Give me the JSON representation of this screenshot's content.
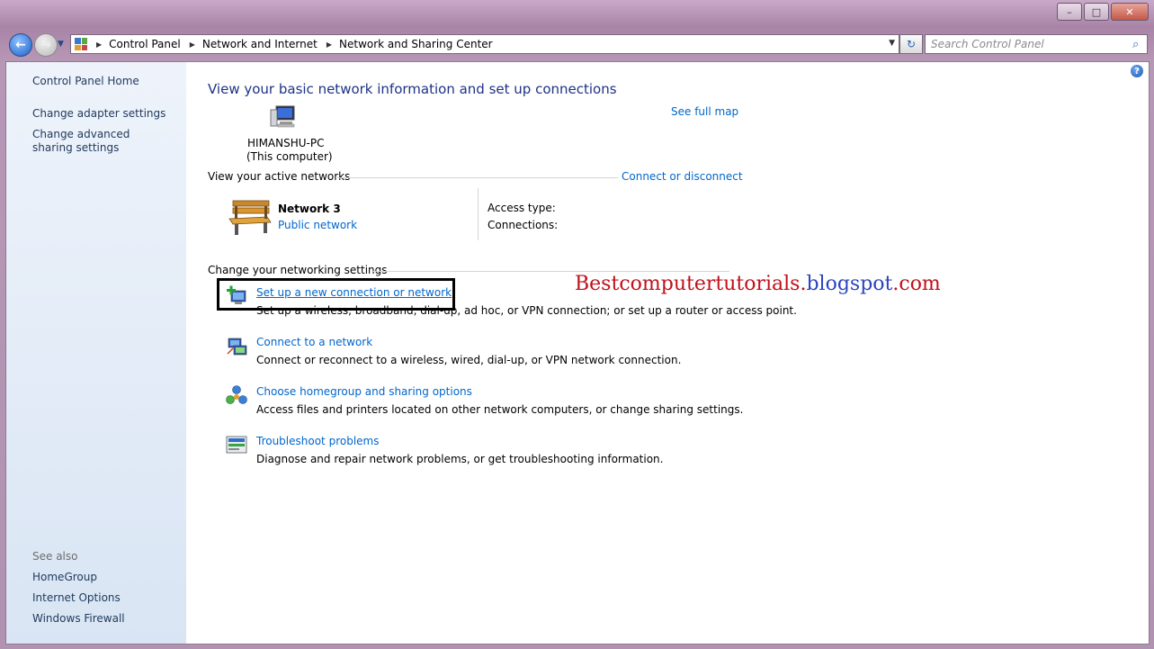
{
  "window": {
    "controls": {
      "minimize": "–",
      "maximize": "□",
      "close": "✕"
    }
  },
  "nav": {
    "back_icon": "back-arrow-icon",
    "forward_icon": "forward-arrow-icon",
    "breadcrumb": [
      "Control Panel",
      "Network and Internet",
      "Network and Sharing Center"
    ],
    "search_placeholder": "Search Control Panel"
  },
  "sidebar": {
    "home": "Control Panel Home",
    "links": [
      "Change adapter settings",
      "Change advanced sharing settings"
    ],
    "see_also_title": "See also",
    "see_also": [
      "HomeGroup",
      "Internet Options",
      "Windows Firewall"
    ]
  },
  "main": {
    "title": "View your basic network information and set up connections",
    "see_full_map": "See full map",
    "computer_name": "HIMANSHU-PC",
    "computer_sub": "(This computer)",
    "active_networks_label": "View your active networks",
    "connect_disconnect": "Connect or disconnect",
    "network_name": "Network  3",
    "network_type": "Public network",
    "access_type_label": "Access type:",
    "connections_label": "Connections:",
    "change_settings_label": "Change your networking settings",
    "tasks": [
      {
        "title": "Set up a new connection or network",
        "desc": "Set up a wireless, broadband, dial-up, ad hoc, or VPN connection; or set up a router or access point."
      },
      {
        "title": "Connect to a network",
        "desc": "Connect or reconnect to a wireless, wired, dial-up, or VPN network connection."
      },
      {
        "title": "Choose homegroup and sharing options",
        "desc": "Access files and printers located on other network computers, or change sharing settings."
      },
      {
        "title": "Troubleshoot problems",
        "desc": "Diagnose and repair network problems, or get troubleshooting information."
      }
    ]
  },
  "watermark": {
    "part1": "Bestcomputertutorials.",
    "part2": "blogspot",
    "part3": ".com"
  },
  "colors": {
    "link": "#0066cc",
    "title": "#1e3287",
    "watermark_red": "#c0101a",
    "watermark_blue": "#2a44c0"
  }
}
